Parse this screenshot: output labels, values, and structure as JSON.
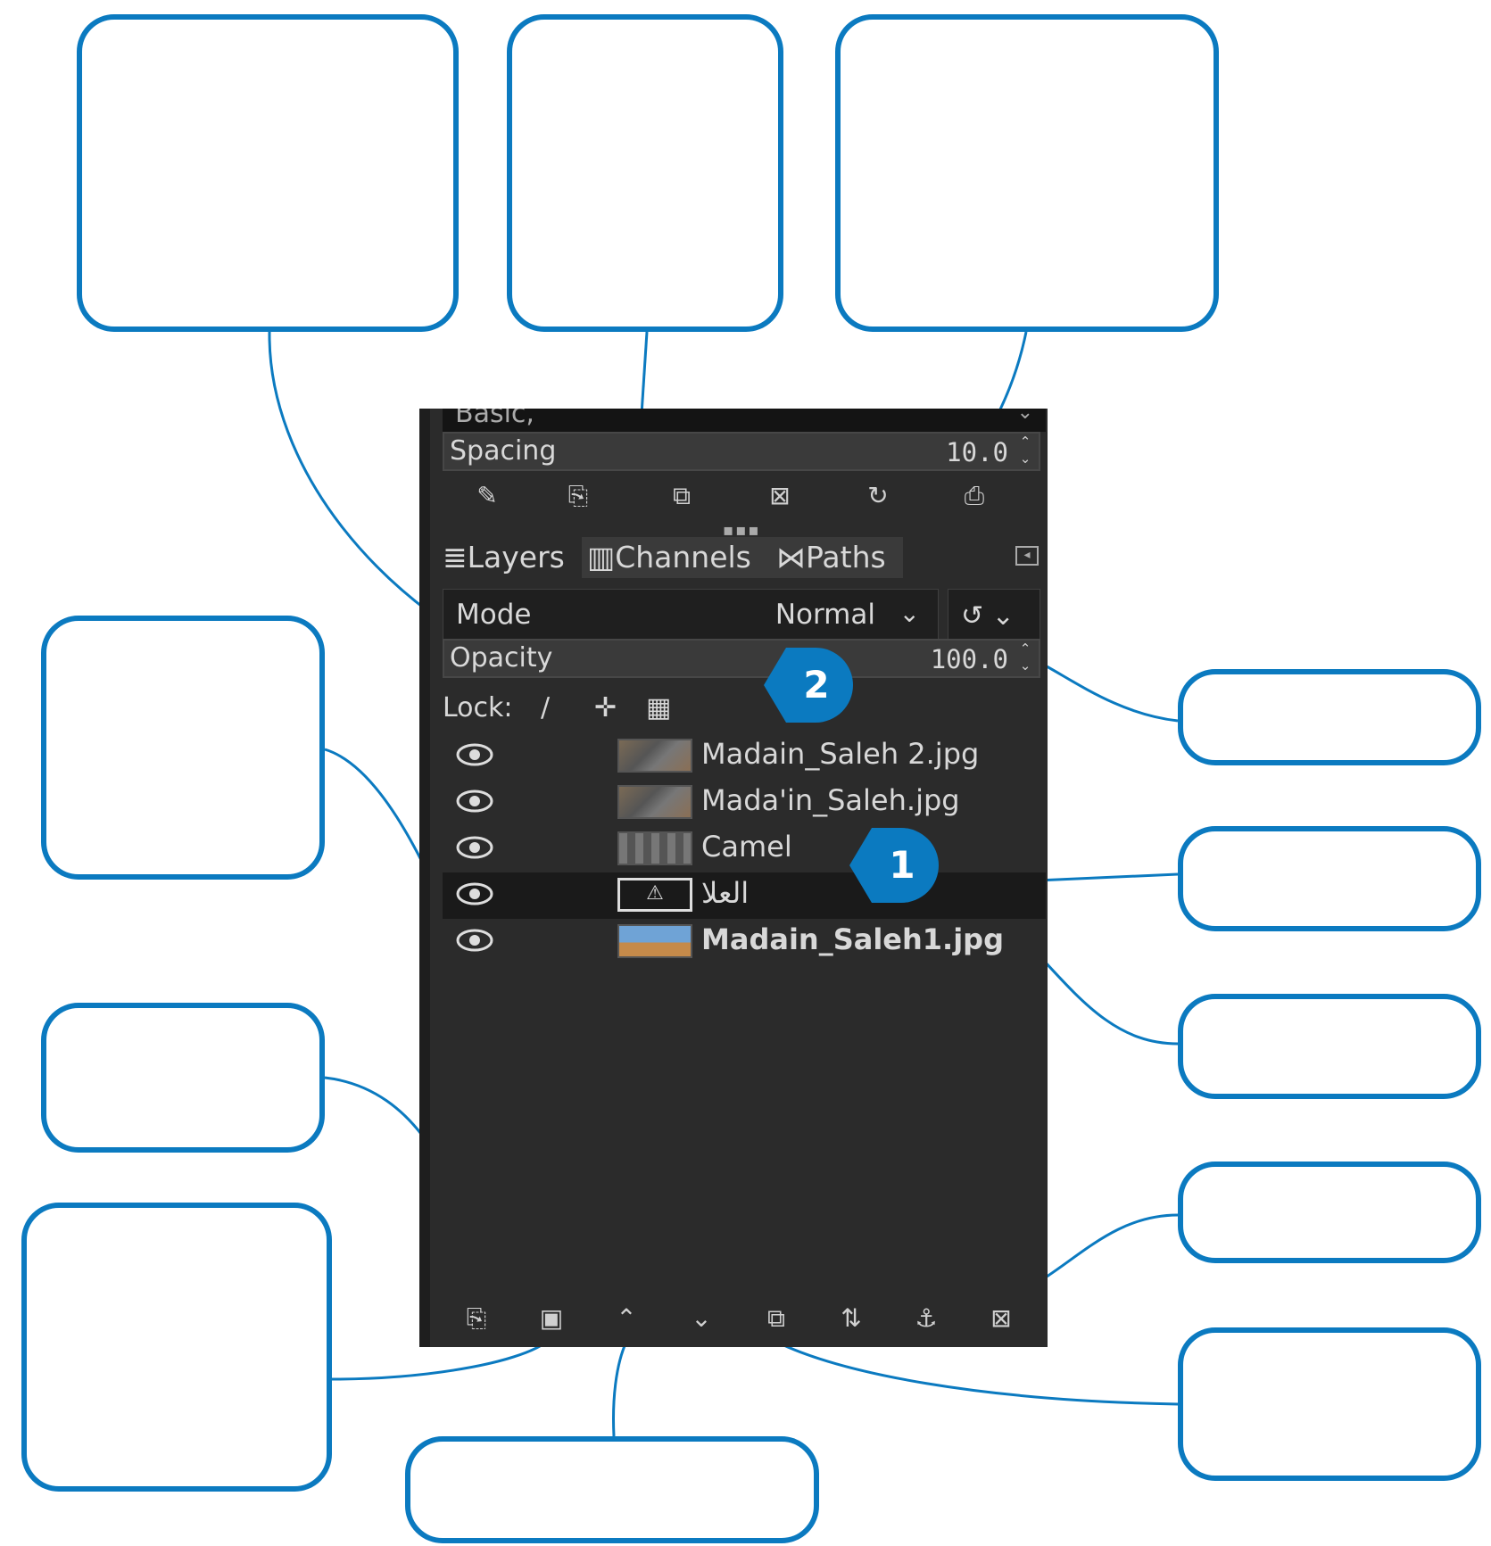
{
  "panel": {
    "preset_label": "Basic,",
    "spacing": {
      "label": "Spacing",
      "value": "10.0"
    },
    "tabs": [
      {
        "label": "Layers",
        "icon": "layers-icon"
      },
      {
        "label": "Channels",
        "icon": "channels-icon"
      },
      {
        "label": "Paths",
        "icon": "paths-icon"
      }
    ],
    "mode": {
      "label": "Mode",
      "value": "Normal"
    },
    "opacity": {
      "label": "Opacity",
      "value": "100.0"
    },
    "lock": {
      "label": "Lock:"
    },
    "layers": [
      {
        "name": "Madain_Saleh 2.jpg",
        "visible": true,
        "thumb": "checker-tint"
      },
      {
        "name": "Mada'in_Saleh.jpg",
        "visible": true,
        "thumb": "checker-tint"
      },
      {
        "name": "Camel",
        "visible": true,
        "thumb": "checker"
      },
      {
        "name": "العلا",
        "visible": true,
        "thumb": "text",
        "selected": true
      },
      {
        "name": "Madain_Saleh1.jpg",
        "visible": true,
        "thumb": "photo",
        "bold": true
      }
    ],
    "bottom_icons": [
      "new-layer-icon",
      "new-group-icon",
      "raise-layer-icon",
      "lower-layer-icon",
      "duplicate-layer-icon",
      "merge-down-icon",
      "anchor-layer-icon",
      "delete-layer-icon"
    ]
  },
  "callouts": {
    "one": "1",
    "two": "2"
  },
  "colors": {
    "accent": "#0b7ac0",
    "panel_bg": "#2b2b2b"
  }
}
